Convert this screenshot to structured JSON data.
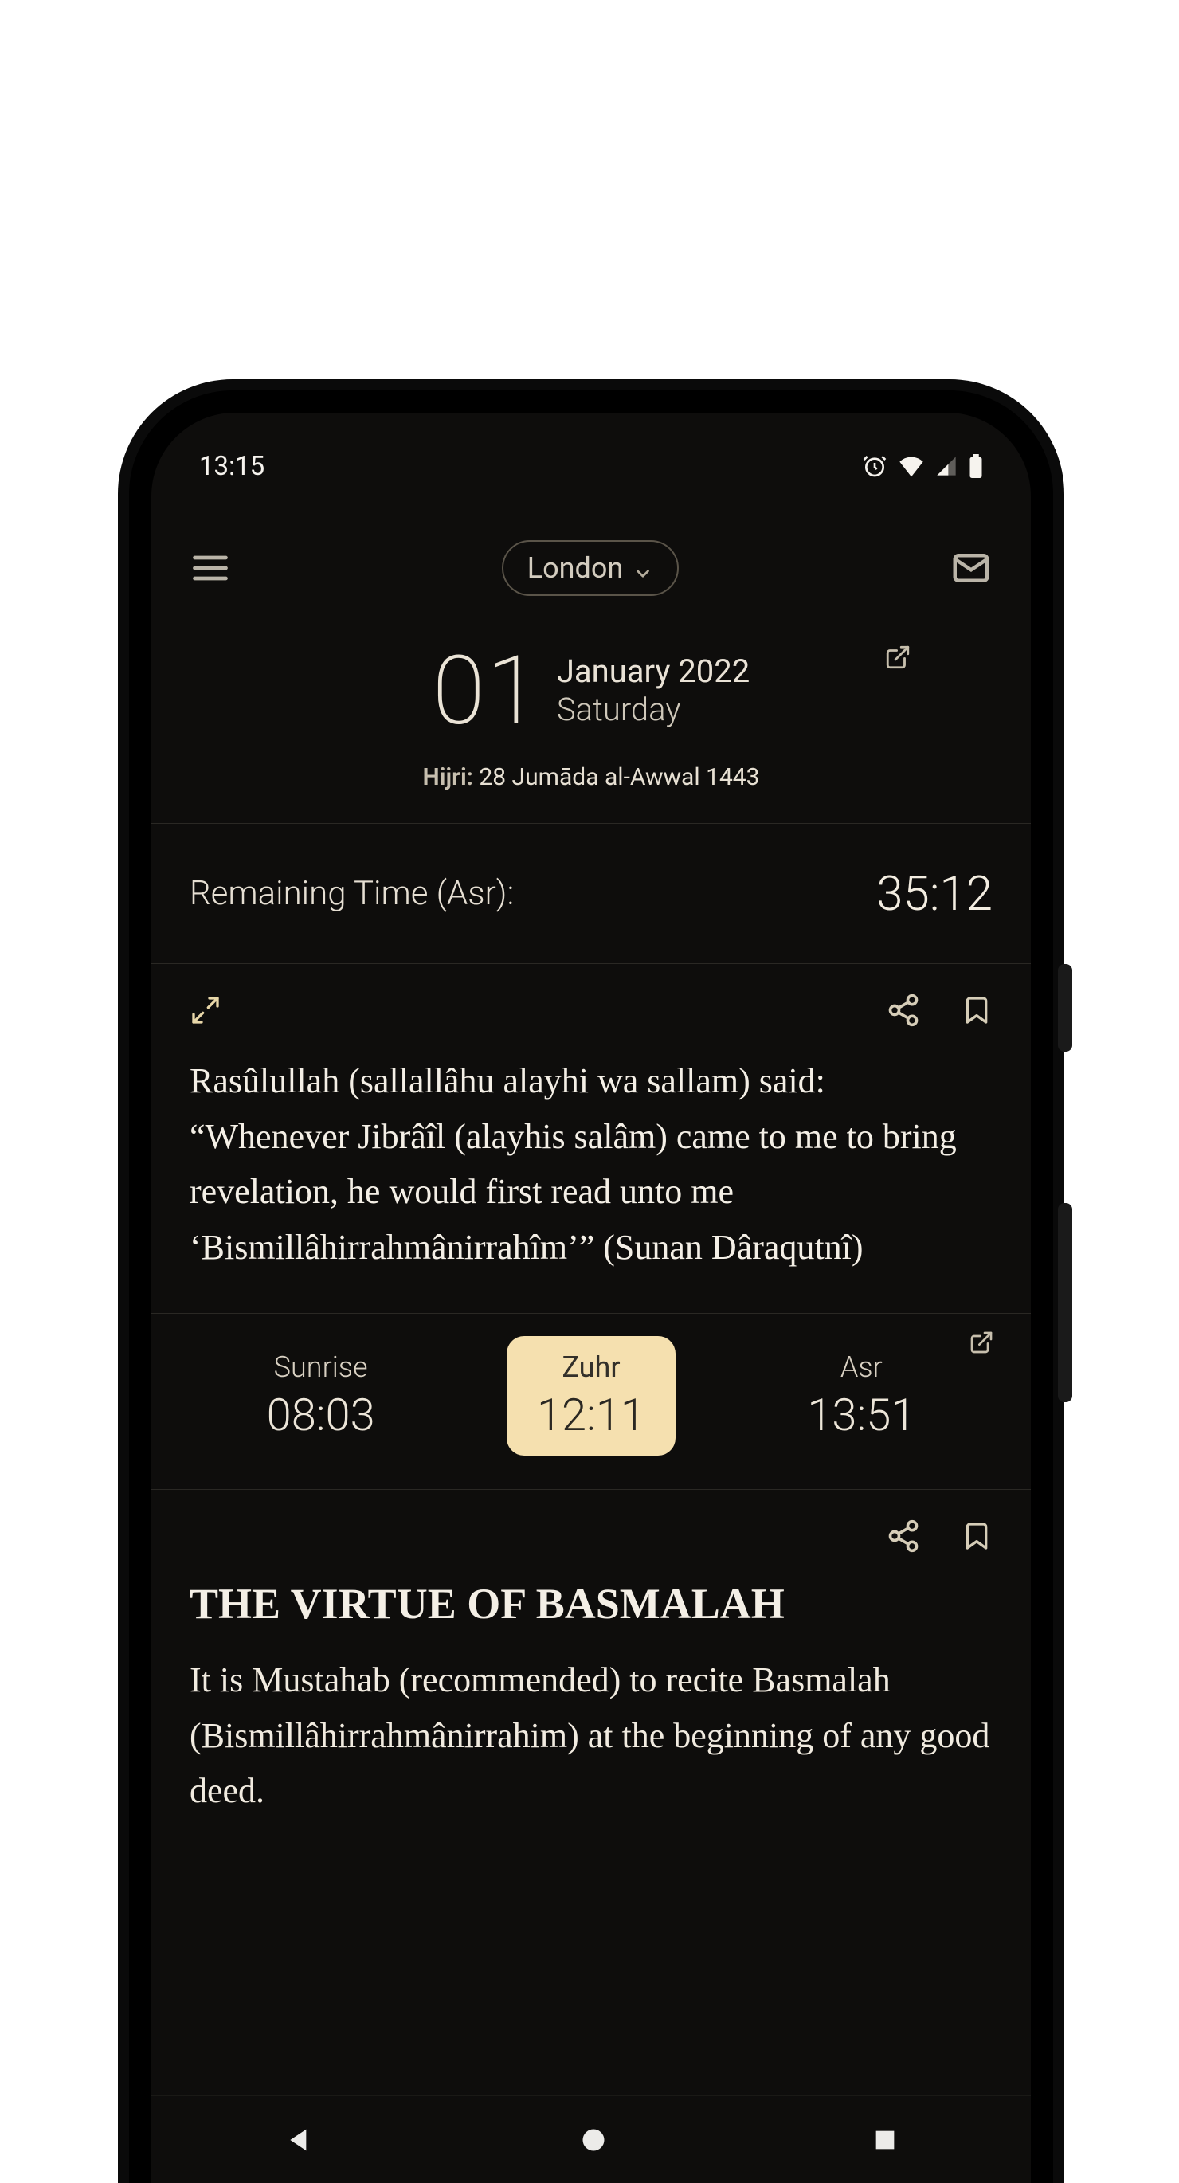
{
  "status": {
    "time": "13:15"
  },
  "appbar": {
    "location": "London"
  },
  "date": {
    "day": "01",
    "month_year": "January 2022",
    "weekday": "Saturday",
    "hijri_label": "Hijri:",
    "hijri_value": "28 Jumāda al-Awwal 1443"
  },
  "remaining": {
    "label": "Remaining Time (Asr):",
    "value": "35:12"
  },
  "hadith": {
    "text": "Rasûlullah (sallallâhu alayhi wa sallam) said: “Whenever Jibrâîl (alayhis salâm) came to me to bring revelation, he would first read unto me ‘Bismillâhirrahmânirrahîm’” (Sunan Dâraqutnî)"
  },
  "prayers": [
    {
      "name": "Sunrise",
      "time": "08:03",
      "active": false
    },
    {
      "name": "Zuhr",
      "time": "12:11",
      "active": true
    },
    {
      "name": "Asr",
      "time": "13:51",
      "active": false
    }
  ],
  "article": {
    "title": "THE VIRTUE OF BASMALAH",
    "text": "It is Mustahab (recommended) to recite Basmalah (Bismillâhirrahmânirrahim) at the beginning of any good deed."
  }
}
